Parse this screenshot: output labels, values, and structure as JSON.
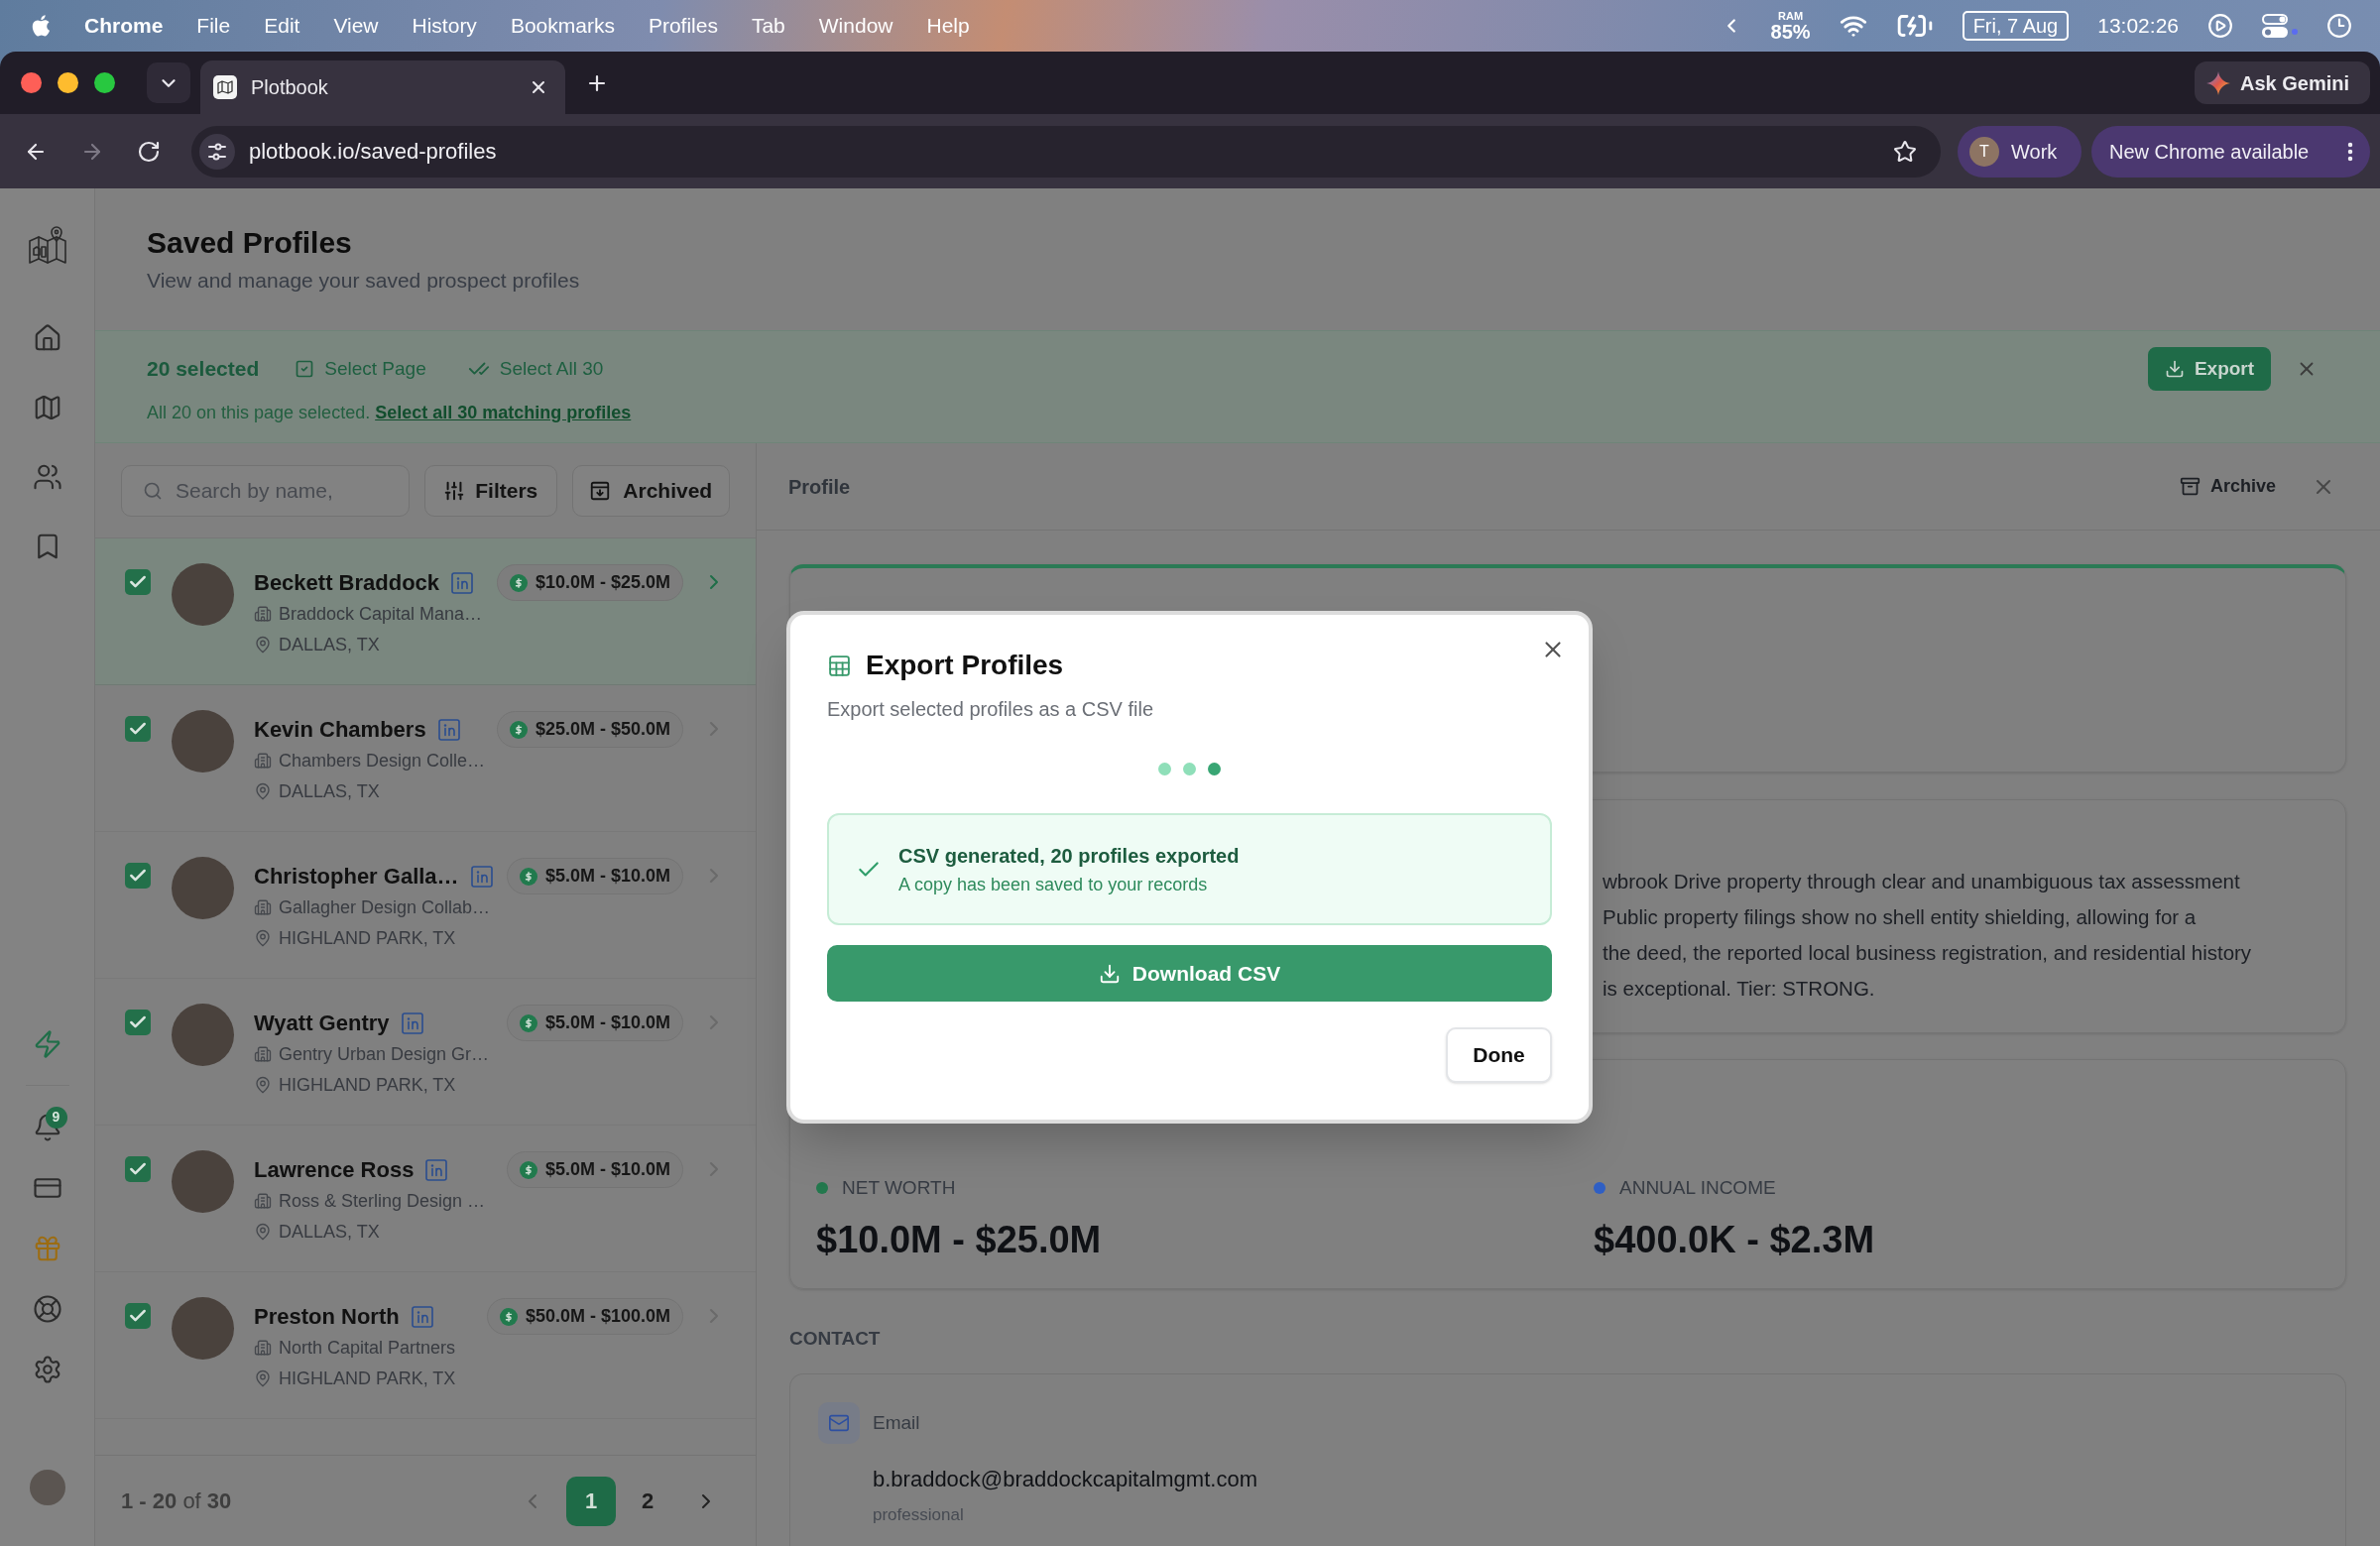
{
  "menu_bar": {
    "app": "Chrome",
    "menus": [
      "File",
      "Edit",
      "View",
      "History",
      "Bookmarks",
      "Profiles",
      "Tab",
      "Window",
      "Help"
    ],
    "ram": {
      "label": "RAM",
      "value": "85%"
    },
    "date": "Fri, 7 Aug",
    "time": "13:02:26"
  },
  "browser": {
    "tab_title": "Plotbook",
    "gemini": "Ask Gemini",
    "url": "plotbook.io/saved-profiles",
    "profile": {
      "initial": "T",
      "name": "Work"
    },
    "update": "New Chrome available"
  },
  "sidebar": {
    "notification_count": "9"
  },
  "header": {
    "title": "Saved Profiles",
    "subtitle": "View and manage your saved prospect profiles"
  },
  "selection_bar": {
    "count": "20 selected",
    "select_page": "Select Page",
    "select_all": "Select All 30",
    "message": "All 20 on this page selected.",
    "link": "Select all 30 matching profiles",
    "export": "Export"
  },
  "list": {
    "search": {
      "placeholder": "Search by name,"
    },
    "filters": "Filters",
    "archived": "Archived",
    "rows": [
      {
        "name": "Beckett Braddock",
        "company": "Braddock Capital Mana…",
        "location": "DALLAS, TX",
        "net_worth": "$10.0M - $25.0M",
        "checked": true,
        "selected": true
      },
      {
        "name": "Kevin Chambers",
        "company": "Chambers Design Colle…",
        "location": "DALLAS, TX",
        "net_worth": "$25.0M - $50.0M",
        "checked": true,
        "selected": false
      },
      {
        "name": "Christopher Galla…",
        "company": "Gallagher Design Collab…",
        "location": "HIGHLAND PARK, TX",
        "net_worth": "$5.0M - $10.0M",
        "checked": true,
        "selected": false
      },
      {
        "name": "Wyatt Gentry",
        "company": "Gentry Urban Design Gr…",
        "location": "HIGHLAND PARK, TX",
        "net_worth": "$5.0M - $10.0M",
        "checked": true,
        "selected": false
      },
      {
        "name": "Lawrence Ross",
        "company": "Ross & Sterling Design …",
        "location": "DALLAS, TX",
        "net_worth": "$5.0M - $10.0M",
        "checked": true,
        "selected": false
      },
      {
        "name": "Preston North",
        "company": "North Capital Partners",
        "location": "HIGHLAND PARK, TX",
        "net_worth": "$50.0M - $100.0M",
        "checked": true,
        "selected": false
      }
    ],
    "range": "**1 - 20** of **30**",
    "pages": [
      {
        "label": "1",
        "selected": true
      },
      {
        "label": "2",
        "selected": false
      }
    ]
  },
  "profile": {
    "title": "Profile",
    "archive": "Archive",
    "summary_fragments": [
      "wbrook Drive property through clear and unambiguous tax assessment",
      "Public property filings show no shell entity shielding, allowing for a",
      "the deed, the reported local business registration, and residential history",
      "is exceptional. Tier: STRONG."
    ],
    "metrics": [
      {
        "label": "NET WORTH",
        "value": "$10.0M - $25.0M",
        "color": "#23784d"
      },
      {
        "label": "ANNUAL INCOME",
        "value": "$400.0K - $2.3M",
        "color": "#2f5fc4"
      }
    ],
    "contact_heading": "CONTACT",
    "email": {
      "label": "Email",
      "value": "b.braddock@braddockcapitalmgmt.com",
      "type": "professional"
    }
  },
  "modal": {
    "title": "Export Profiles",
    "subtitle": "Export selected profiles as a CSV file",
    "progress_dots": [
      {
        "active": false
      },
      {
        "active": false
      },
      {
        "active": true
      }
    ],
    "result": {
      "title": "CSV generated, 20 profiles exported",
      "detail": "A copy has been saved to your records"
    },
    "download": "Download CSV",
    "done": "Done"
  }
}
